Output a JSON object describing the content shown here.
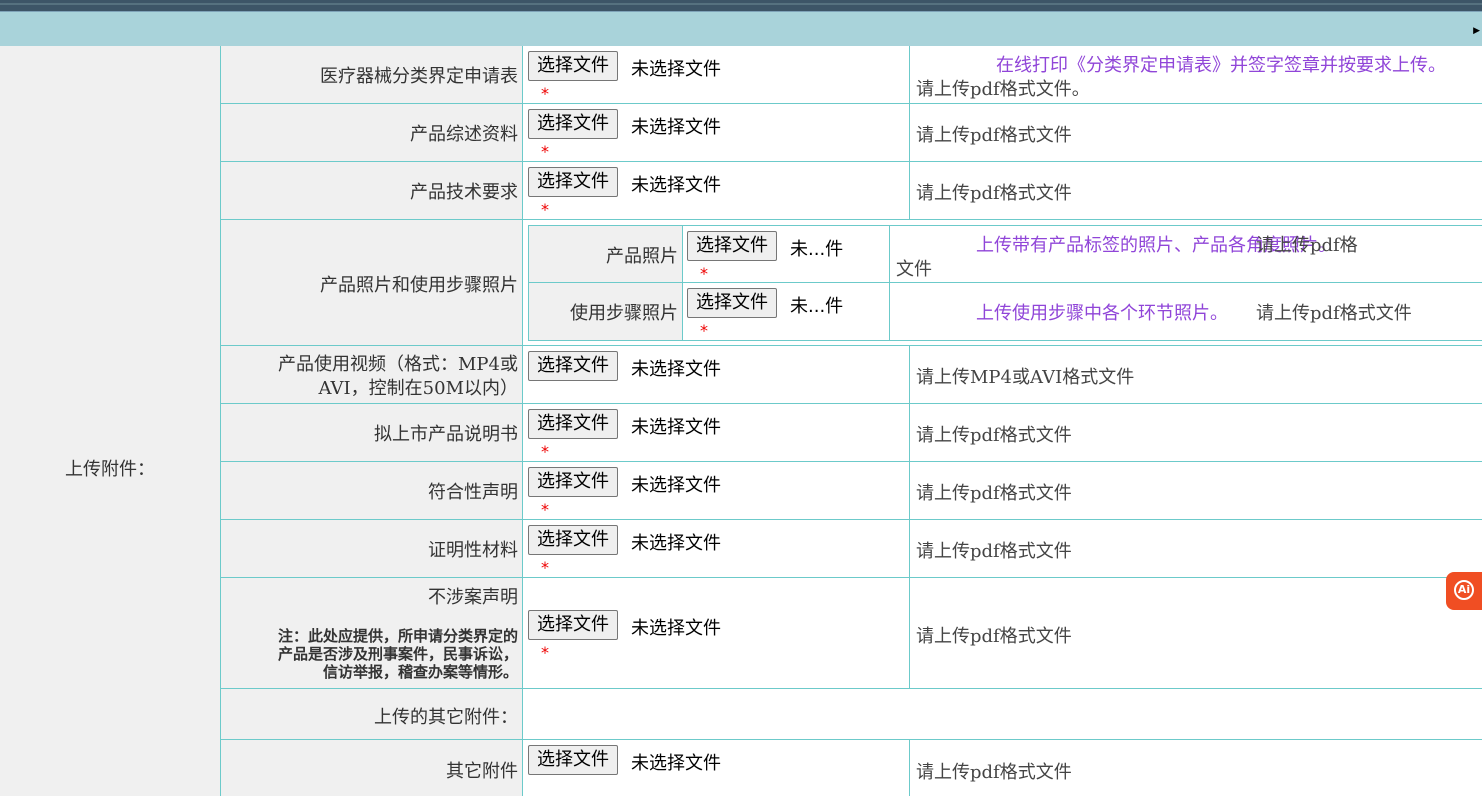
{
  "upload_section_label": "上传附件：",
  "file_button_label": "选择文件",
  "no_file_label": "未选择文件",
  "no_file_short_label": "未...件",
  "required_mark": "*",
  "rows": [
    {
      "label": "医疗器械分类界定申请表",
      "desc_purple": "在线打印《分类界定申请表》并签字签章并按要求上传。",
      "desc": "请上传pdf格式文件。"
    },
    {
      "label": "产品综述资料",
      "desc": "请上传pdf格式文件"
    },
    {
      "label": "产品技术要求",
      "desc": "请上传pdf格式文件"
    },
    {
      "label": "产品照片和使用步骤照片",
      "sub": [
        {
          "label": "产品照片",
          "desc_purple": "上传带有产品标签的照片、产品各角度照片。",
          "desc": "请上传pdf格",
          "desc_wrap": "文件"
        },
        {
          "label": "使用步骤照片",
          "desc_purple": "上传使用步骤中各个环节照片。",
          "desc": "请上传pdf格式文件"
        }
      ]
    },
    {
      "label_line1": "产品使用视频（格式：MP4或",
      "label_line2": "AVI，控制在50M以内）",
      "desc": "请上传MP4或AVI格式文件"
    },
    {
      "label": "拟上市产品说明书",
      "desc": "请上传pdf格式文件"
    },
    {
      "label": "符合性声明",
      "desc": "请上传pdf格式文件"
    },
    {
      "label": "证明性材料",
      "desc": "请上传pdf格式文件"
    },
    {
      "label": "不涉案声明",
      "note_line1": "注：此处应提供，所申请分类界定的",
      "note_line2": "产品是否涉及刑事案件，民事诉讼，",
      "note_line3": "信访举报，稽查办案等情形。",
      "desc": "请上传pdf格式文件"
    },
    {
      "label": "上传的其它附件："
    },
    {
      "label": "其它附件",
      "desc": "请上传pdf格式文件"
    }
  ],
  "ai_label": "Ai"
}
